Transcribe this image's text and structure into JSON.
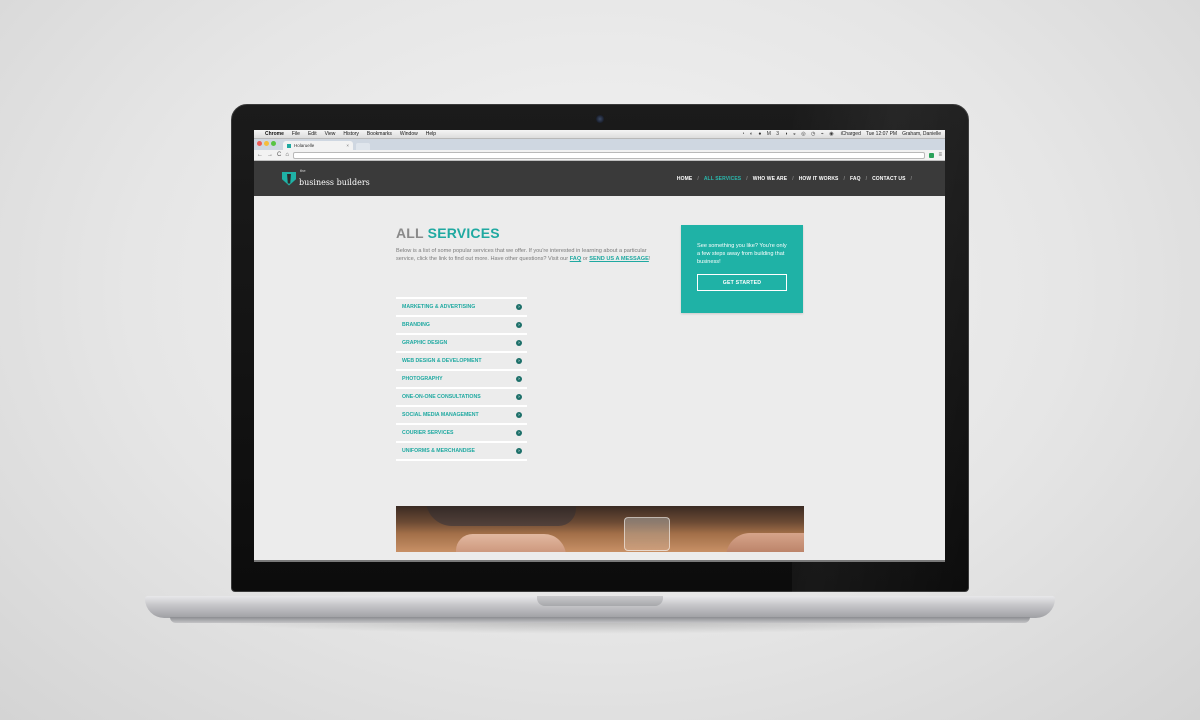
{
  "mac_menubar": {
    "app": "Chrome",
    "menus": [
      "File",
      "Edit",
      "View",
      "History",
      "Bookmarks",
      "Window",
      "Help"
    ],
    "status_icons": "◔ ◐ ● M 3 ◑ ◒ ◎ ◷ ⌁ ◉",
    "status_text": "iCharged",
    "clock": "Tue 12:07 PM",
    "user": "Graham, Danielle"
  },
  "browser": {
    "tab_title": "Holaruelle",
    "tab_close": "×",
    "back": "←",
    "forward": "→",
    "reload": "C",
    "home": "⌂",
    "menu": "≡"
  },
  "site": {
    "logo": {
      "small": "the",
      "big": "business builders"
    },
    "nav": [
      {
        "label": "HOME",
        "active": false
      },
      {
        "label": "ALL SERVICES",
        "active": true
      },
      {
        "label": "WHO WE ARE",
        "active": false
      },
      {
        "label": "HOW IT WORKS",
        "active": false
      },
      {
        "label": "FAQ",
        "active": false
      },
      {
        "label": "CONTACT US",
        "active": false
      }
    ],
    "nav_separator": "/"
  },
  "page": {
    "title_light": "ALL ",
    "title_bold": "SERVICES",
    "intro_text": "Below is a list of some popular services that we offer. If you're interested in learning about a particular service, click the link to find out more. Have other questions? Visit our ",
    "intro_link_faq": "FAQ",
    "intro_or": " or ",
    "intro_link_message": "SEND US A MESSAGE",
    "intro_end": "!",
    "services": [
      "Marketing & Advertising",
      "Branding",
      "Graphic Design",
      "Web Design & Development",
      "Photography",
      "One-on-One Consultations",
      "Social Media Management",
      "Courier Services",
      "Uniforms & Merchandise"
    ],
    "service_arrow": "›",
    "cta": {
      "text": "See something you like? You're only a few steps away from building that business!",
      "button": "GET STARTED"
    }
  },
  "colors": {
    "accent": "#1fb2a6",
    "header_bg": "#3a3a3a",
    "page_bg": "#ececec"
  }
}
